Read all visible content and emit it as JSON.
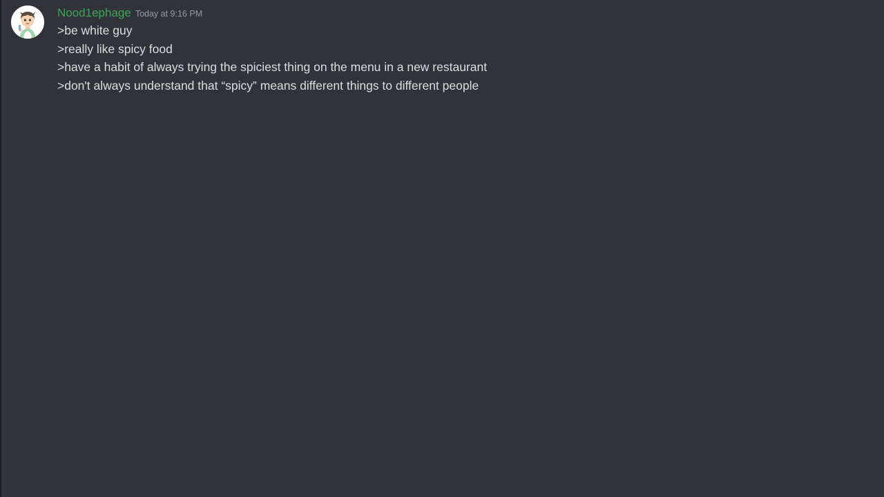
{
  "message": {
    "author": "Nood1ephage",
    "timestamp": "Today at 9:16 PM",
    "avatar_icon": "cartoon-boy-avatar",
    "lines": [
      ">be white guy",
      ">really like spicy food",
      ">have a habit of always trying the spiciest thing on the menu in a new restaurant",
      ">don't always understand that “spicy” means different things to different people"
    ]
  },
  "colors": {
    "background": "#313338",
    "username": "#3ba55d",
    "timestamp": "#949ba4",
    "text": "#dbdee1"
  }
}
